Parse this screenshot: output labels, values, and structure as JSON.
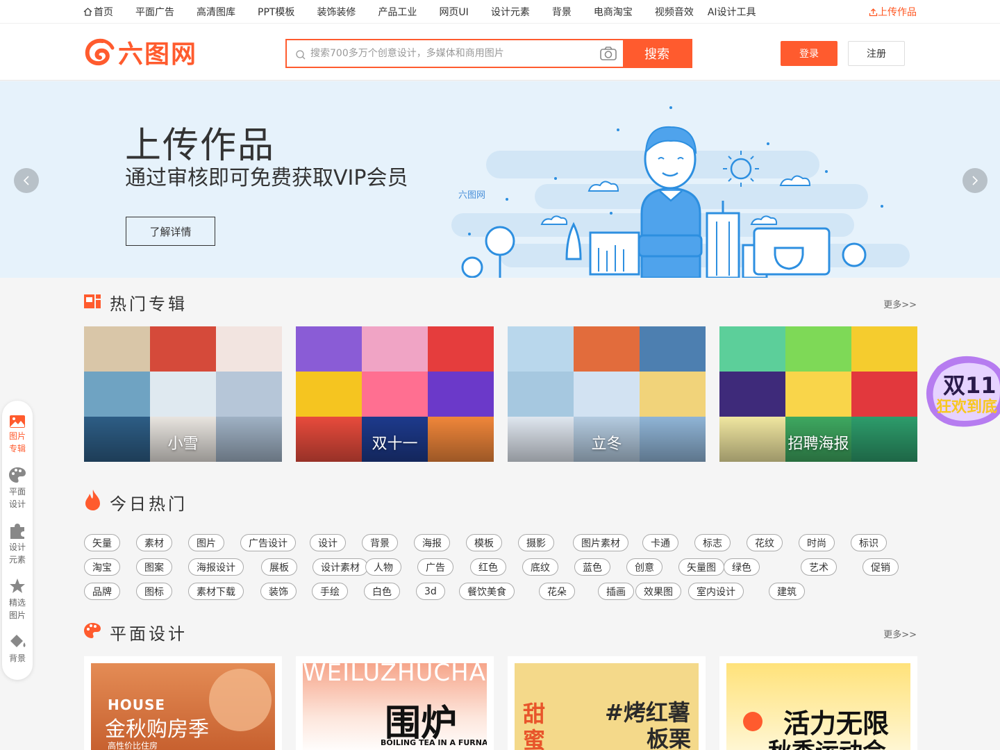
{
  "topnav": {
    "items": [
      "首页",
      "平面广告",
      "高清图库",
      "PPT模板",
      "装饰装修",
      "产品工业",
      "网页UI",
      "设计元素",
      "背景",
      "电商淘宝",
      "视频音效",
      "AI设计工具"
    ],
    "upload": "上传作品"
  },
  "header": {
    "logo": "六图网",
    "search_placeholder": "搜索700多万个创意设计，多媒体和商用图片",
    "search_button": "搜索",
    "login": "登录",
    "register": "注册"
  },
  "banner": {
    "title": "上传作品",
    "subtitle": "通过审核即可免费获取VIP会员",
    "button": "了解详情",
    "illustration_logo": "六图网"
  },
  "hot_albums": {
    "title": "热门专辑",
    "more": "更多>>",
    "albums": [
      {
        "label": "小雪",
        "colors": [
          "#d9c6a8",
          "#d54a3a",
          "#f2e4e0",
          "#6fa3c2",
          "#dfe9f0",
          "#b6c6d8",
          "#2d5d85",
          "#e8e4df",
          "#9fb1c4"
        ]
      },
      {
        "label": "双十一",
        "colors": [
          "#8a5cd6",
          "#f0a4c5",
          "#e53d3d",
          "#f5c520",
          "#ff6f91",
          "#6b39c9",
          "#e84b3c",
          "#1d3a8c",
          "#f0863a"
        ]
      },
      {
        "label": "立冬",
        "colors": [
          "#b9d7ec",
          "#e26c3c",
          "#4d7fb0",
          "#a6c8e0",
          "#d2e2f2",
          "#f1d37a",
          "#dfe6ef",
          "#b4cbe0",
          "#8fb4d6"
        ]
      },
      {
        "label": "招聘海报",
        "colors": [
          "#5ccf9a",
          "#7ed957",
          "#f5cc2e",
          "#3e2a7a",
          "#f9d54a",
          "#e2383d",
          "#f0e6a0",
          "#3ea860",
          "#2d9c6b"
        ]
      }
    ]
  },
  "today_hot": {
    "title": "今日热门",
    "rows": [
      [
        "矢量",
        "素材",
        "图片",
        "广告设计",
        "设计",
        "背景",
        "海报",
        "模板",
        "摄影",
        "图片素材",
        "卡通",
        "标志",
        "花纹",
        "时尚",
        "标识"
      ],
      [
        "淘宝",
        "图案",
        "海报设计",
        "展板",
        "设计素材",
        "人物",
        "广告",
        "红色",
        "底纹",
        "蓝色",
        "创意",
        "矢量图",
        "绿色",
        "艺术",
        "促销"
      ],
      [
        "品牌",
        "图标",
        "素材下载",
        "装饰",
        "手绘",
        "白色",
        "3d",
        "餐饮美食",
        "花朵",
        "插画",
        "效果图",
        "室内设计",
        "建筑"
      ]
    ]
  },
  "graphic_design": {
    "title": "平面设计",
    "more": "更多>>",
    "cards": [
      {
        "line1": "HOUSE",
        "line2": "金秋购房季",
        "line3": "高性价比住房"
      },
      {
        "line1": "WEILUZHUCHA",
        "line2": "围炉",
        "line3": "BOILING TEA IN A FURNACE"
      },
      {
        "line1": "#烤红薯",
        "line2": "板栗",
        "line3": "甜蜜"
      },
      {
        "line1": "活力无限",
        "line2": "秋季运动会"
      }
    ]
  },
  "sidebar": {
    "items": [
      {
        "label1": "图片",
        "label2": "专辑"
      },
      {
        "label1": "平面",
        "label2": "设计"
      },
      {
        "label1": "设计",
        "label2": "元素"
      },
      {
        "label1": "精选",
        "label2": "图片"
      },
      {
        "label1": "背景",
        "label2": ""
      }
    ]
  },
  "promo": {
    "line1": "双11",
    "line2": "狂欢到底"
  },
  "colors": {
    "brand": "#ff5b2e",
    "banner_bg": "#e6f2fb",
    "page_bg": "#f5f5f5"
  }
}
